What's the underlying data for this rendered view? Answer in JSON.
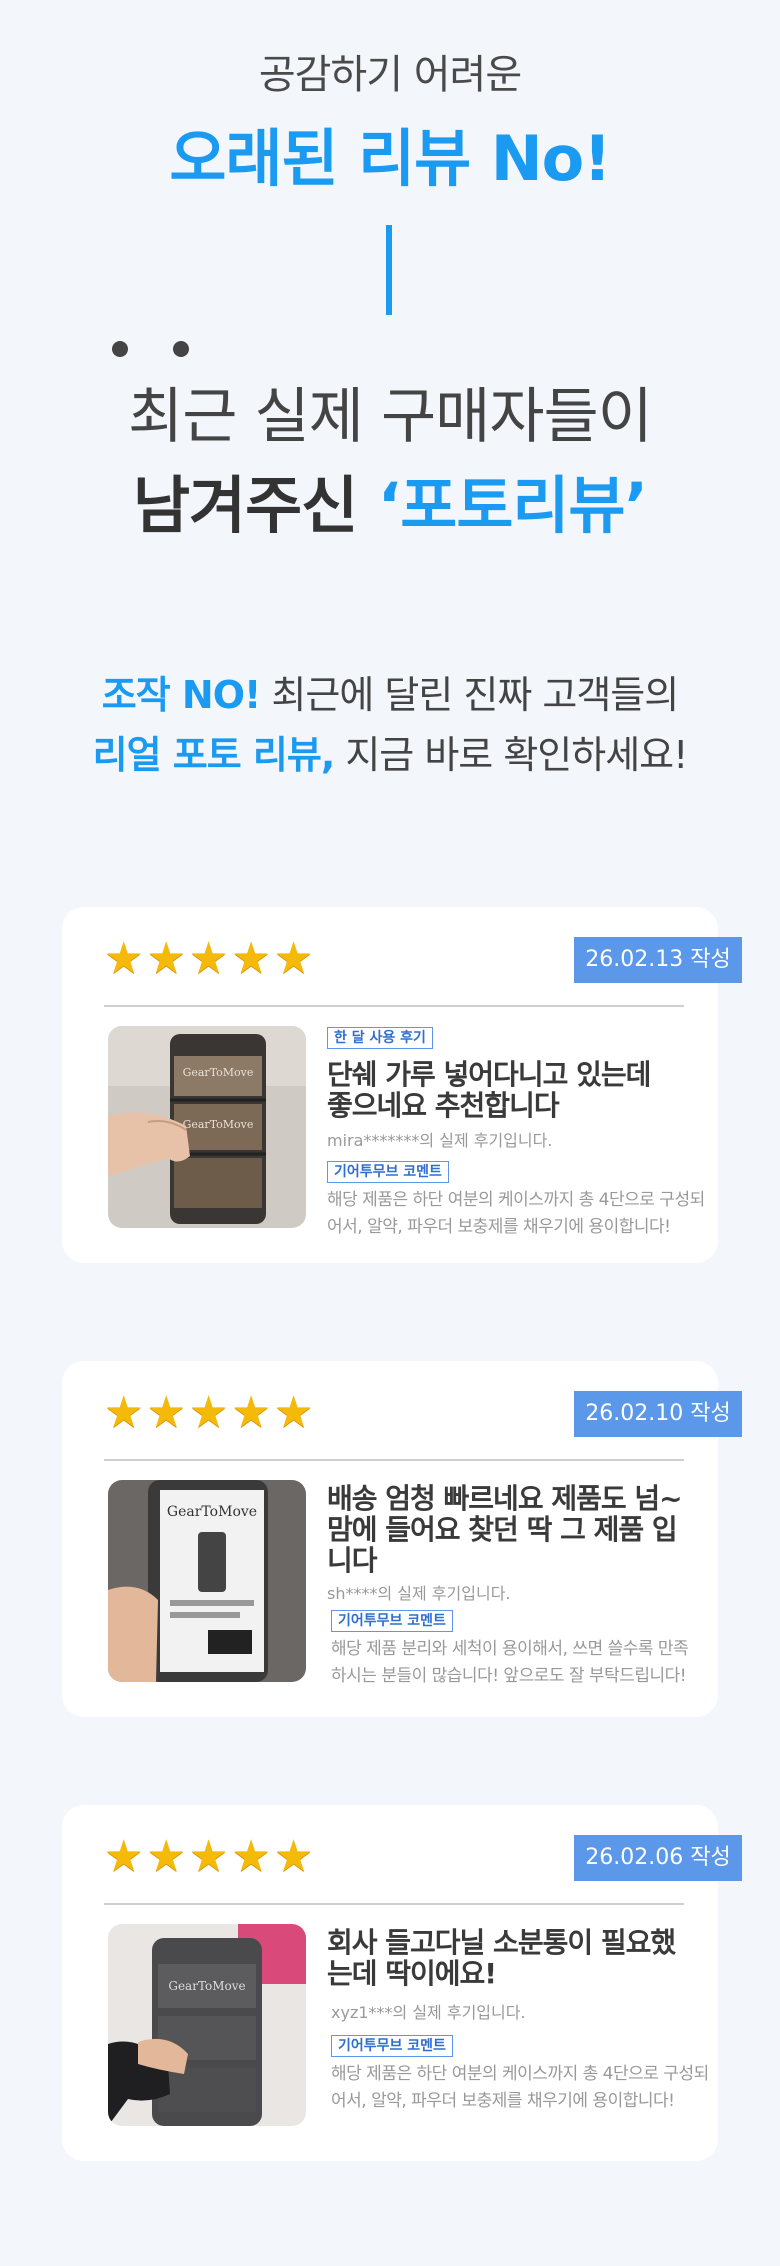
{
  "header": {
    "subtitle": "공감하기 어려운",
    "title": "오래된 리뷰 No!",
    "line1": "최근 실제 구매자들이",
    "line2_black": "남겨주신 ",
    "line2_blue": "‘포토리뷰’"
  },
  "intro": {
    "l1_blue": "조작 NO!",
    "l1_rest": " 최근에 달린 진짜 고객들의",
    "l2_blue": "리얼 포토 리뷰,",
    "l2_rest": " 지금 바로 확인하세요!"
  },
  "reviews": [
    {
      "rating": 5,
      "date": "26.02.13 작성",
      "badge": "한 달 사용 후기",
      "title_lines": [
        "단쉐 가루 넣어다니고 있는데",
        "좋으네요 추천합니다"
      ],
      "author": "mira*******의 실제 후기입니다.",
      "comment_tag": "기어투무브 코멘트",
      "comment_lines": [
        "해당 제품은 하단 여분의 케이스까지 총 4단으로 구성되",
        "어서, 알약, 파우더 보충제를 채우기에 용이합니다!"
      ]
    },
    {
      "rating": 5,
      "date": "26.02.10 작성",
      "title_lines": [
        "배송 엄청 빠르네요 제품도 넘~",
        "맘에 들어요 찾던 딱 그 제품 입",
        "니다"
      ],
      "author": "sh****의 실제 후기입니다.",
      "comment_tag": "기어투무브 코멘트",
      "comment_lines": [
        "해당 제품 분리와 세척이 용이해서, 쓰면 쓸수록 만족",
        "하시는 분들이 많습니다! 앞으로도 잘 부탁드립니다!"
      ]
    },
    {
      "rating": 5,
      "date": "26.02.06 작성",
      "title_lines": [
        "회사 들고다닐 소분통이 필요했",
        "는데 딱이에요!"
      ],
      "author": "xyz1***의 실제 후기입니다.",
      "comment_tag": "기어투무브 코멘트",
      "comment_lines": [
        "해당 제품은 하단 여분의 케이스까지 총 4단으로 구성되",
        "어서, 알약, 파우더 보충제를 채우기에 용이합니다!"
      ]
    }
  ],
  "brand_label": "GearToMove",
  "colors": {
    "accent": "#1a9af0",
    "date_bg": "#5b98ea",
    "star": "#f5b90a"
  }
}
